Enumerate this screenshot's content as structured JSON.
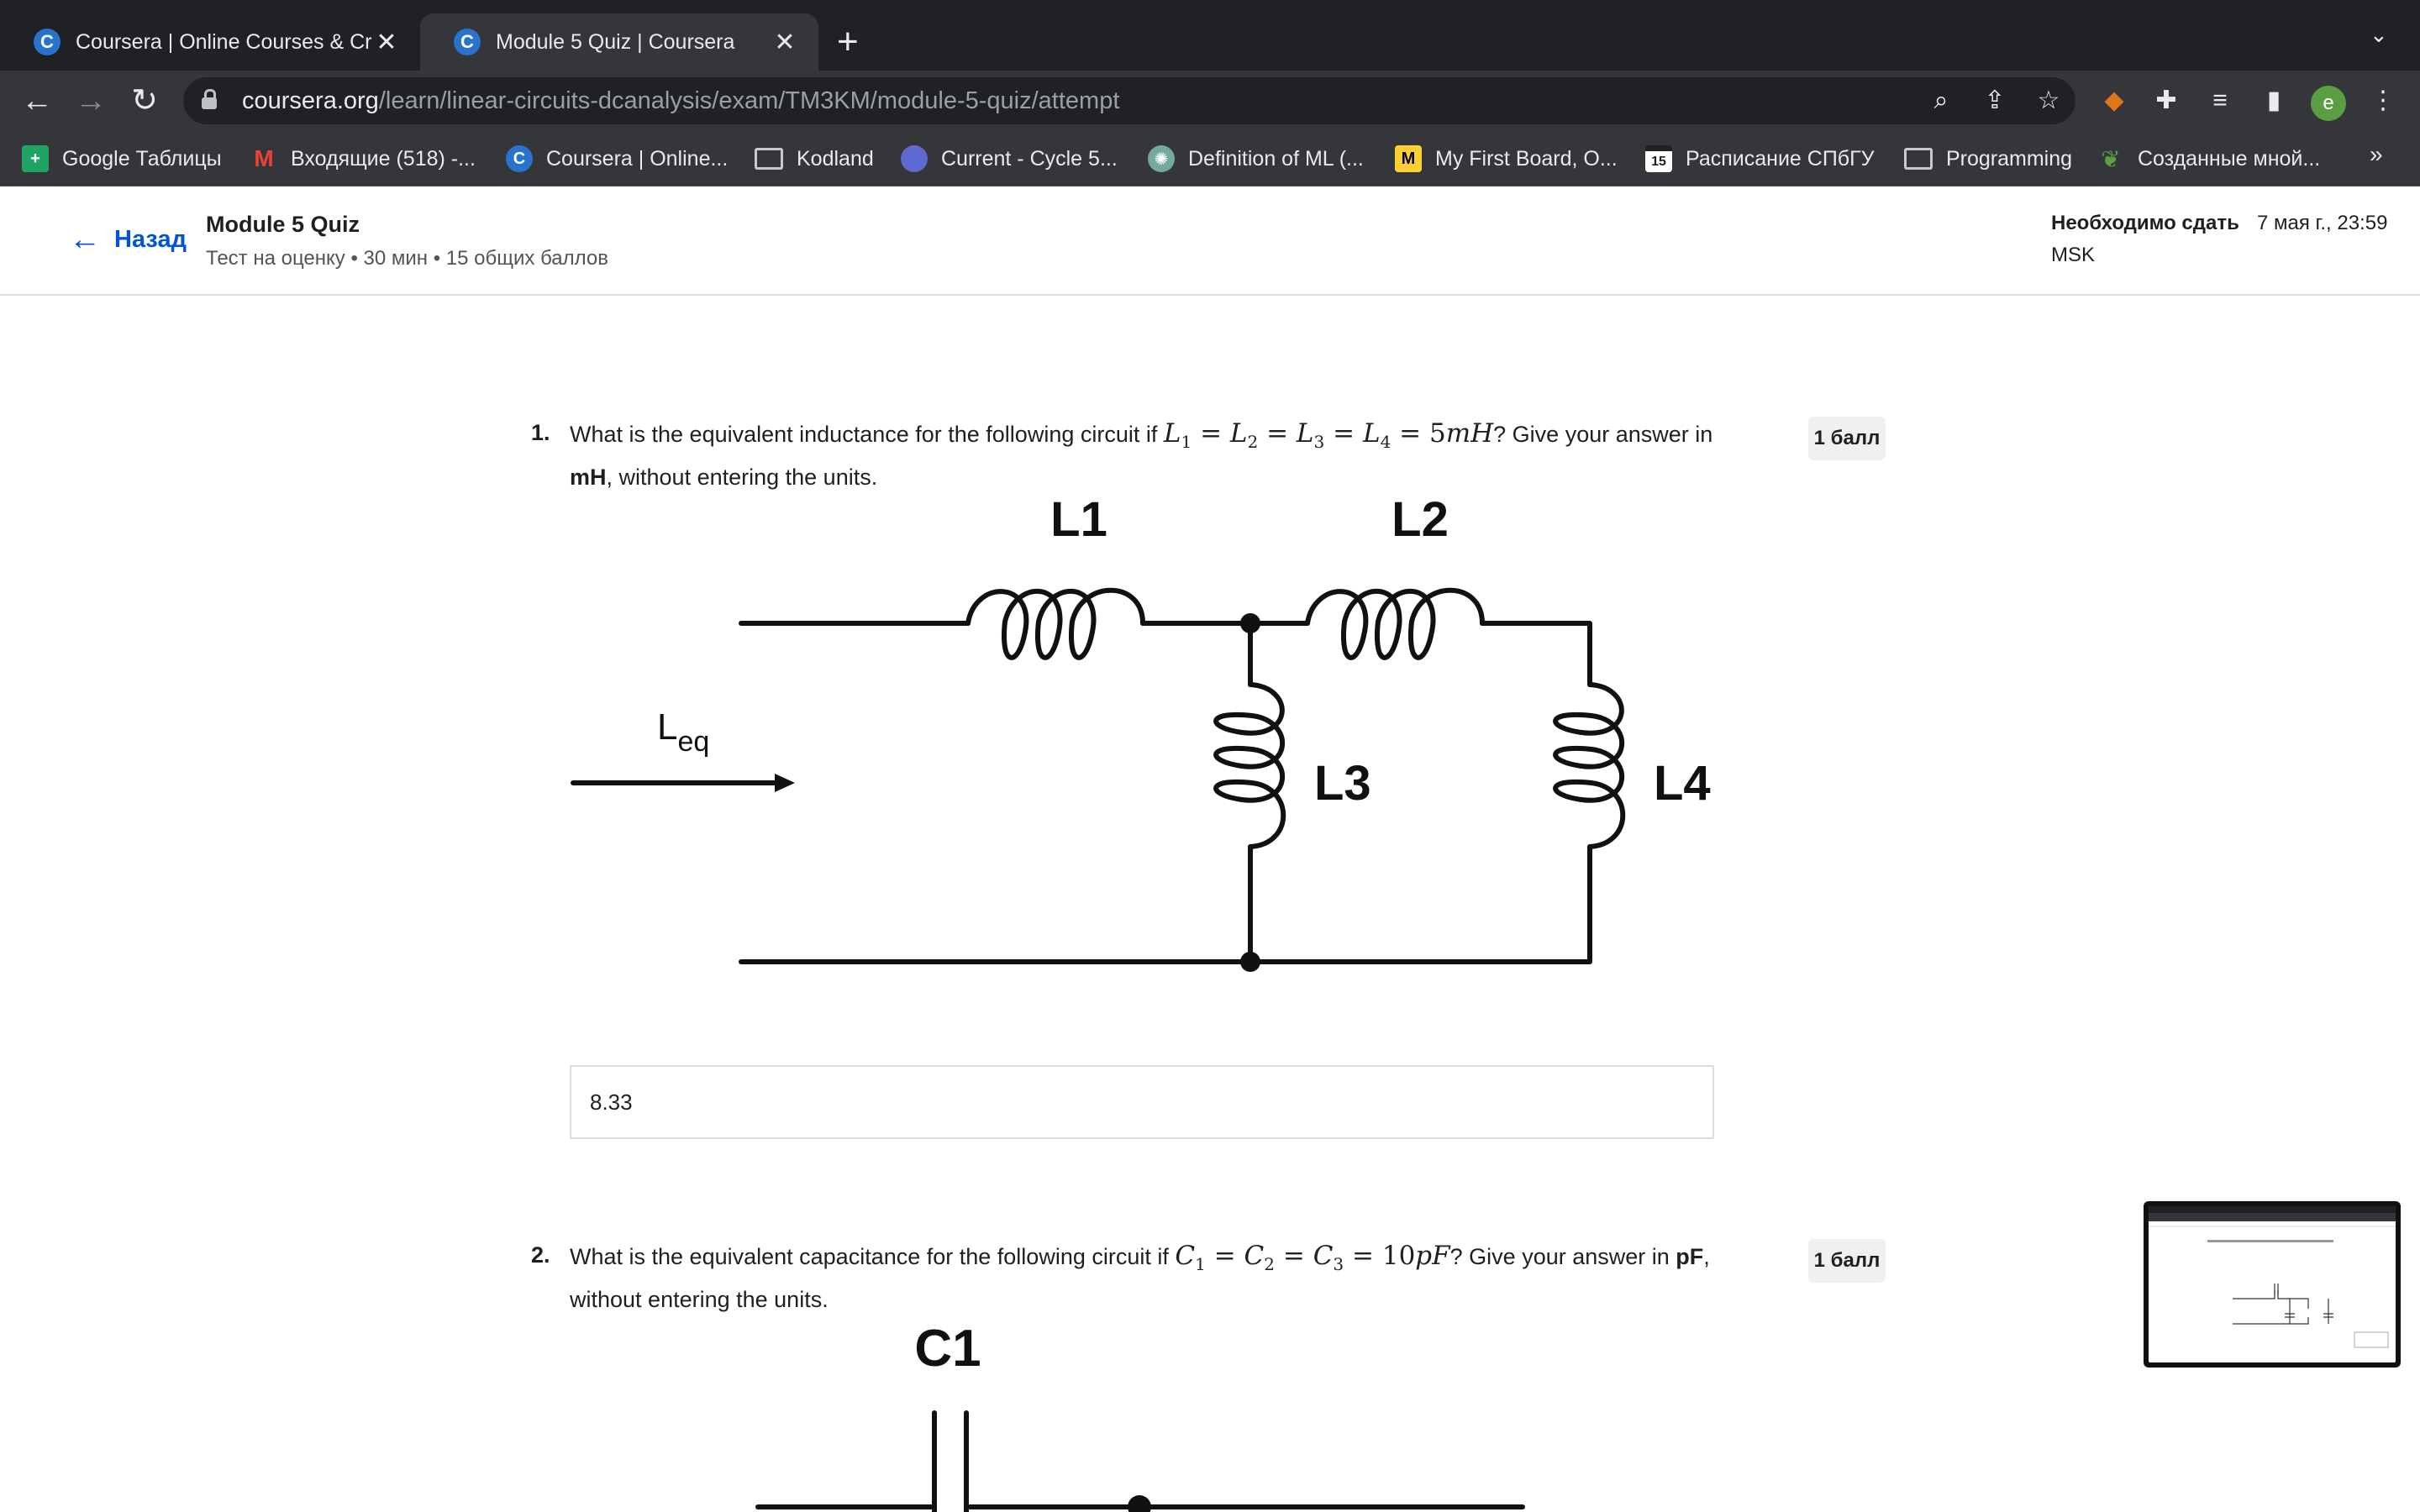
{
  "browser": {
    "tabs": [
      {
        "title": "Coursera | Online Courses & Cr",
        "favicon": "C",
        "active": false
      },
      {
        "title": "Module 5 Quiz | Coursera",
        "favicon": "C",
        "active": true
      }
    ],
    "new_tab_icon": "+",
    "url": {
      "host": "coursera.org",
      "path": "/learn/linear-circuits-dcanalysis/exam/TM3KM/module-5-quiz/attempt"
    },
    "avatar_letter": "e",
    "bookmarks": [
      {
        "label": "Google Таблицы",
        "icon": "sheets-icon",
        "color": "#1fa463"
      },
      {
        "label": "Входящие (518) -...",
        "icon": "gmail-icon",
        "color": "#ea4335"
      },
      {
        "label": "Coursera | Online...",
        "icon": "coursera-icon",
        "color": "#2a73cc"
      },
      {
        "label": "Kodland",
        "icon": "folder-icon",
        "color": ""
      },
      {
        "label": "Current - Cycle 5...",
        "icon": "linear-icon",
        "color": "#5e6ad2"
      },
      {
        "label": "Definition of ML (...",
        "icon": "chatgpt-icon",
        "color": "#74aa9c"
      },
      {
        "label": "My First Board, O...",
        "icon": "miro-icon",
        "color": "#ffd02f"
      },
      {
        "label": "Расписание СПбГУ",
        "icon": "calendar-icon",
        "color": "#ffffff"
      },
      {
        "label": "Programming",
        "icon": "folder-icon",
        "color": ""
      },
      {
        "label": "Созданные мной...",
        "icon": "leaf-icon",
        "color": "#5a9e44"
      }
    ],
    "bookmarks_more": "»"
  },
  "header": {
    "back_label": "Назад",
    "quiz_title": "Module 5 Quiz",
    "quiz_subtitle": "Тест на оценку • 30 мин • 15 общих баллов",
    "due_label": "Необходимо сдать",
    "due_date": "7 мая г., 23:59",
    "due_timezone": "MSK"
  },
  "questions": [
    {
      "number": "1.",
      "text_before": "What is the equivalent inductance for the following circuit if ",
      "text_after": "? Give your answer in ",
      "unit": "mH",
      "text_end": ", without entering the units.",
      "points": "1 балл",
      "answer": "8.33",
      "circuit_labels": {
        "l1": "L1",
        "l2": "L2",
        "l3": "L3",
        "l4": "L4",
        "leq_base": "L",
        "leq_sub": "eq"
      }
    },
    {
      "number": "2.",
      "text_before": "What is the equivalent capacitance for the following circuit if ",
      "text_after": "? Give your answer in ",
      "unit": "pF",
      "text_end": ", without entering the units.",
      "points": "1 балл",
      "circuit_labels": {
        "c1": "C1"
      }
    }
  ]
}
